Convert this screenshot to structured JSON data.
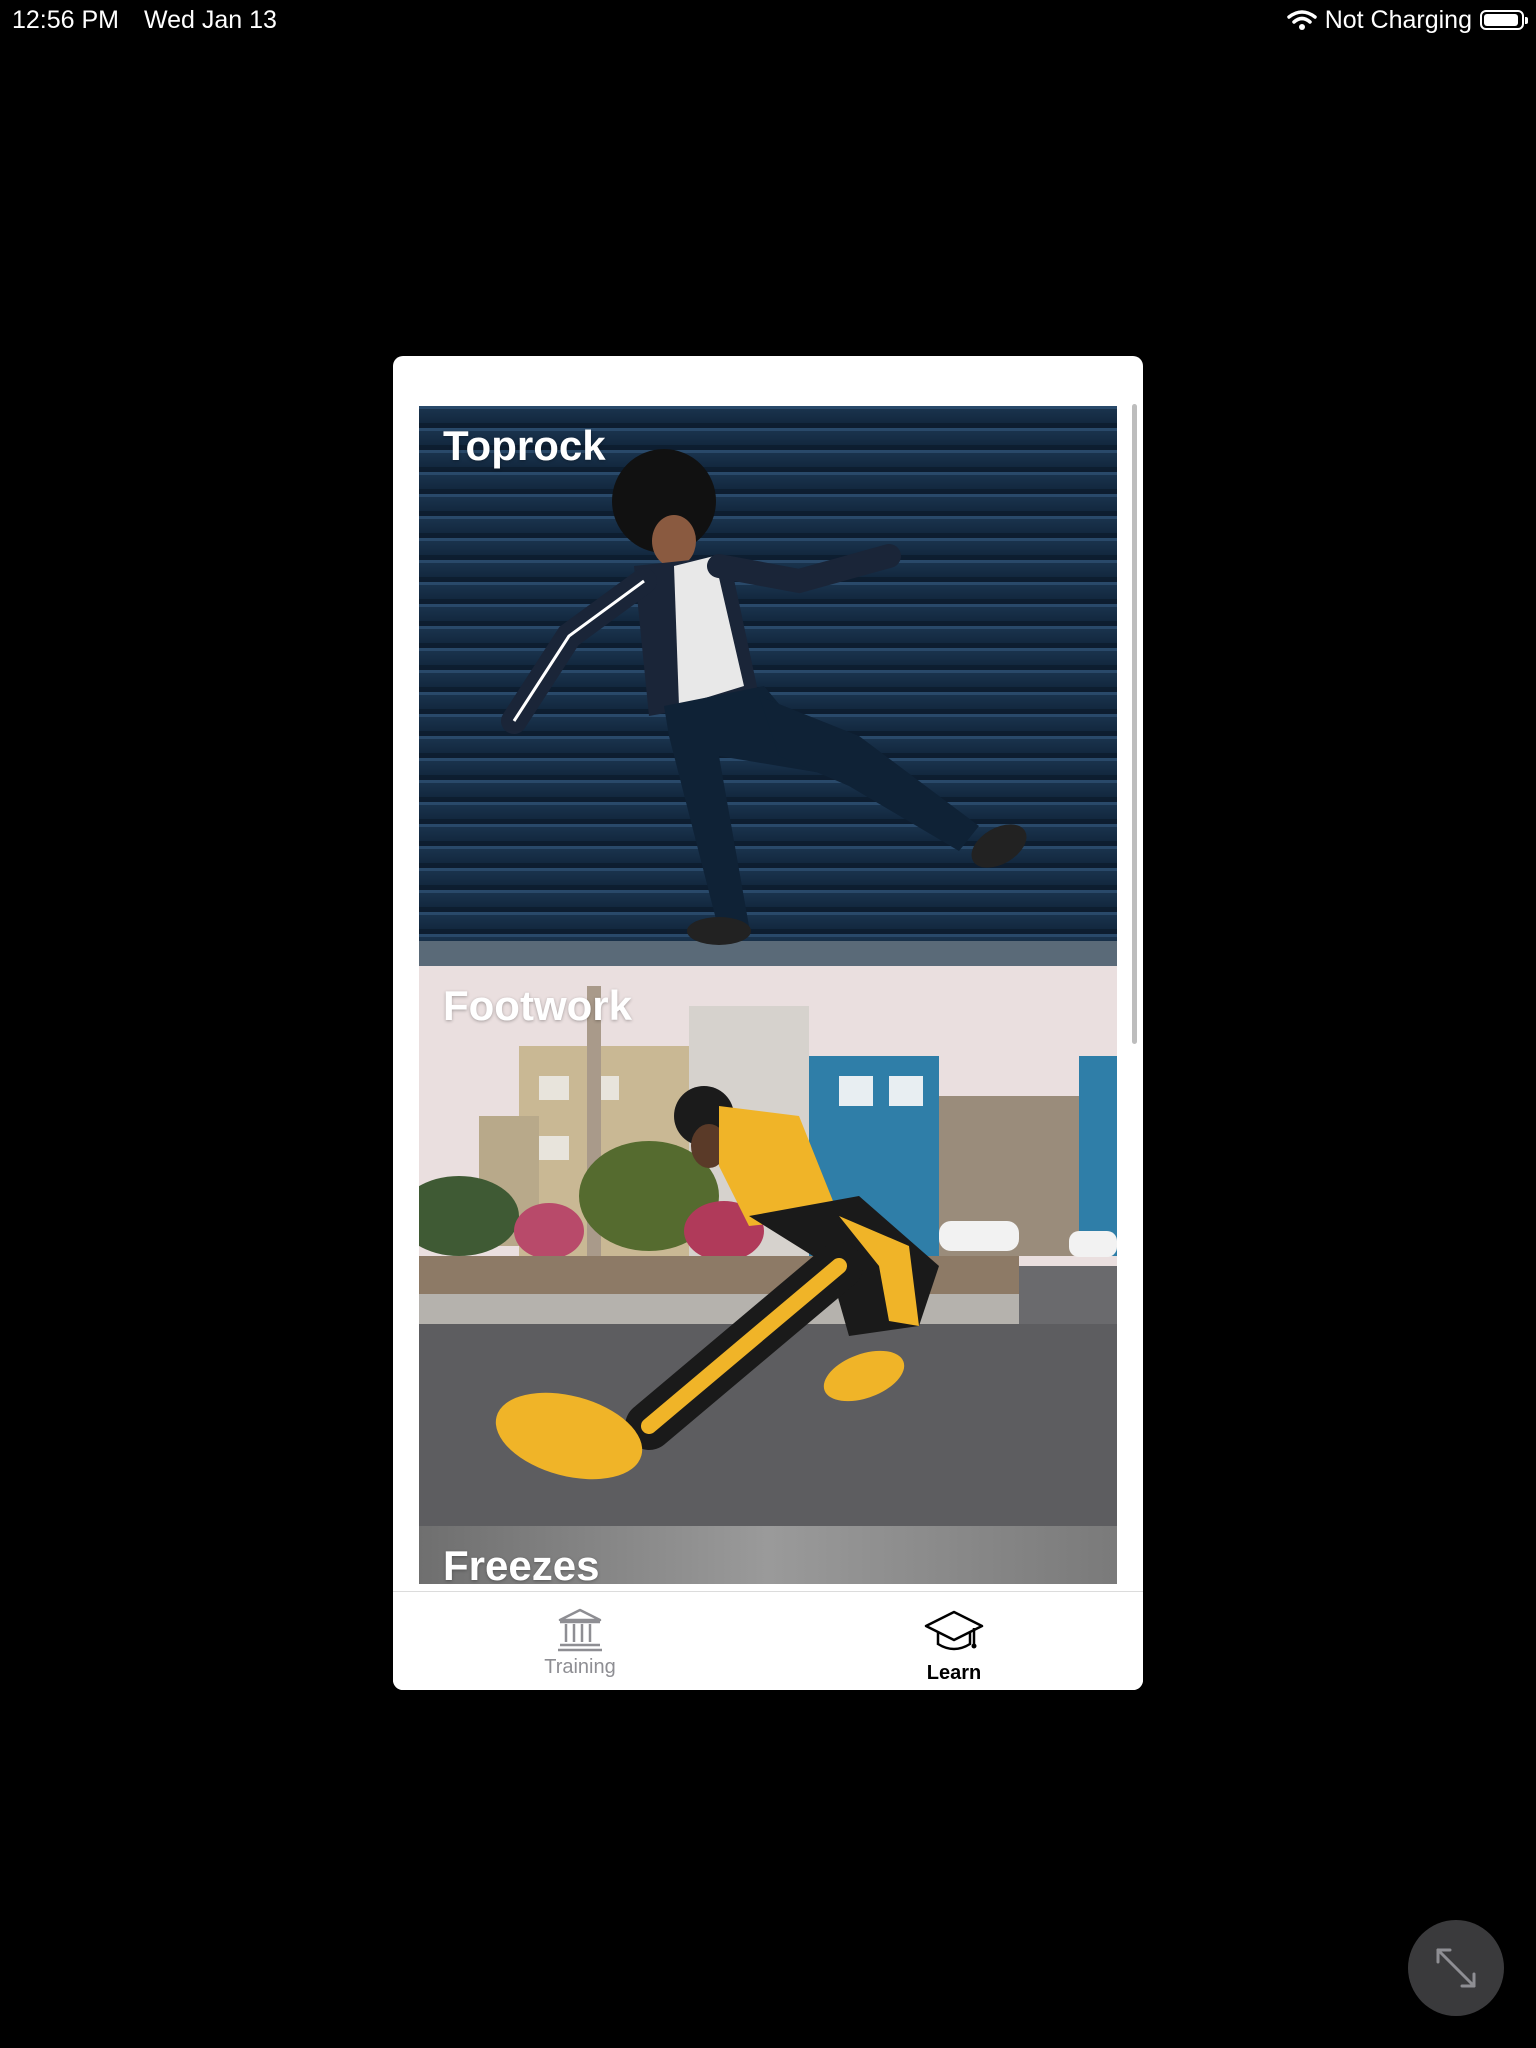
{
  "status_bar": {
    "time": "12:56 PM",
    "date": "Wed Jan 13",
    "charging": "Not Charging",
    "icons": [
      "wifi-icon",
      "battery-icon"
    ]
  },
  "learn": {
    "cards": [
      {
        "title": "Toprock"
      },
      {
        "title": "Footwork"
      },
      {
        "title": "Freezes"
      }
    ]
  },
  "tab_bar": {
    "tabs": [
      {
        "label": "Training",
        "icon": "bank-icon",
        "selected": false
      },
      {
        "label": "Learn",
        "icon": "graduation-cap-icon",
        "selected": true
      }
    ]
  },
  "colors": {
    "background": "#000000",
    "window": "#ffffff",
    "tab_inactive": "#8e8e93",
    "tab_active": "#000000"
  },
  "expand_button": {
    "icon": "expand-icon"
  }
}
